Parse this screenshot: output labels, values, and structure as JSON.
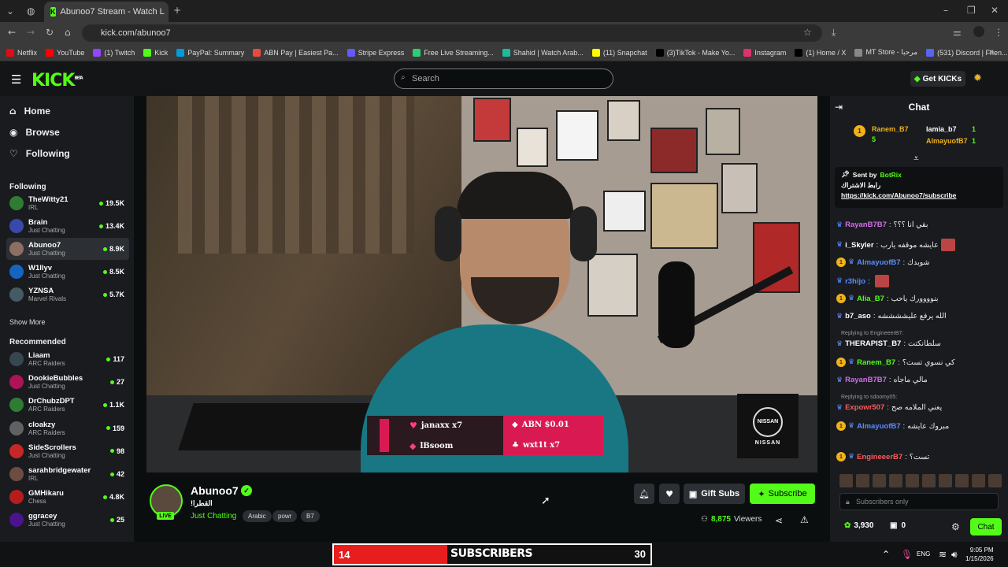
{
  "browser": {
    "tab_title": "Abunoo7 Stream - Watch L",
    "url": "kick.com/abunoo7",
    "bookmarks": [
      {
        "label": "Netflix",
        "color": "#e50914"
      },
      {
        "label": "YouTube",
        "color": "#ff0000"
      },
      {
        "label": "(1) Twitch",
        "color": "#9146ff"
      },
      {
        "label": "Kick",
        "color": "#53fc18"
      },
      {
        "label": "PayPal: Summary",
        "color": "#009cde"
      },
      {
        "label": "ABN Pay | Easiest Pa...",
        "color": "#e84b3c"
      },
      {
        "label": "Stripe Express",
        "color": "#635bff"
      },
      {
        "label": "Free Live Streaming...",
        "color": "#2ecc71"
      },
      {
        "label": "Shahid | Watch Arab...",
        "color": "#1abc9c"
      },
      {
        "label": "(11) Snapchat",
        "color": "#fffc00"
      },
      {
        "label": "(3)TikTok - Make Yo...",
        "color": "#000000"
      },
      {
        "label": "Instagram",
        "color": "#e1306c"
      },
      {
        "label": "(1) Home / X",
        "color": "#000000"
      },
      {
        "label": "MT Store - مرحبا",
        "color": "#888888"
      },
      {
        "label": "(531) Discord | Frien...",
        "color": "#5865f2"
      }
    ]
  },
  "header": {
    "logo": "KICK",
    "logo_sup": "BETA",
    "search_placeholder": "Search",
    "get_kicks": "Get KICKs"
  },
  "sidebar": {
    "nav": [
      {
        "label": "Home",
        "icon": "home-icon"
      },
      {
        "label": "Browse",
        "icon": "browse-icon"
      },
      {
        "label": "Following",
        "icon": "heart-icon"
      }
    ],
    "following_heading": "Following",
    "following": [
      {
        "name": "TheWitty21",
        "category": "IRL",
        "viewers": "19.5K",
        "color": "#2e7d32"
      },
      {
        "name": "Brain",
        "category": "Just Chatting",
        "viewers": "13.4K",
        "color": "#3949ab"
      },
      {
        "name": "Abunoo7",
        "category": "Just Chatting",
        "viewers": "8.9K",
        "color": "#8d6e63"
      },
      {
        "name": "W1llyv",
        "category": "Just Chatting",
        "viewers": "8.5K",
        "color": "#1565c0"
      },
      {
        "name": "YZNSA",
        "category": "Marvel Rivals",
        "viewers": "5.7K",
        "color": "#455a64"
      }
    ],
    "show_more": "Show More",
    "recommended_heading": "Recommended",
    "recommended": [
      {
        "name": "Liaam",
        "category": "ARC Raiders",
        "viewers": "117",
        "color": "#37474f"
      },
      {
        "name": "DookieBubbles",
        "category": "Just Chatting",
        "viewers": "27",
        "color": "#ad1457"
      },
      {
        "name": "DrChubzDPT",
        "category": "ARC Raiders",
        "viewers": "1.1K",
        "color": "#2e7d32"
      },
      {
        "name": "cloakzy",
        "category": "ARC Raiders",
        "viewers": "159",
        "color": "#616161"
      },
      {
        "name": "SideScrollers",
        "category": "Just Chatting",
        "viewers": "98",
        "color": "#c62828"
      },
      {
        "name": "sarahbridgewater",
        "category": "IRL",
        "viewers": "42",
        "color": "#6d4c41"
      },
      {
        "name": "GMHikaru",
        "category": "Chess",
        "viewers": "4.8K",
        "color": "#b71c1c"
      },
      {
        "name": "ggracey",
        "category": "Just Chatting",
        "viewers": "25",
        "color": "#4a148c"
      }
    ]
  },
  "video_overlay": {
    "alerts": [
      {
        "text": "janaxx x7"
      },
      {
        "text": "lBsoom"
      },
      {
        "text": "ABN $0.01"
      },
      {
        "text": "wxt1t x7"
      }
    ],
    "sponsor": "NISSAN"
  },
  "channel": {
    "name": "Abunoo7",
    "live": "LIVE",
    "title": "!القطرا",
    "category": "Just Chatting",
    "tags": [
      "Arabic",
      "powr",
      "B7"
    ],
    "gift_subs": "Gift Subs",
    "subscribe": "Subscribe",
    "viewers": "8,875",
    "viewers_label": "Viewers"
  },
  "chat": {
    "title": "Chat",
    "leaderboard": [
      {
        "rank": "1",
        "name": "Ranem_B7",
        "count": "5"
      },
      {
        "name": "lamia_b7",
        "count": "1"
      },
      {
        "name": "AlmayuofB7",
        "count": "1"
      }
    ],
    "pinned": {
      "sent_by": "Sent by",
      "bot": "BotRix",
      "line1": "رابط الاشتراك",
      "link": "https://kick.com/Abunoo7/subscribe"
    },
    "messages": [
      {
        "user": "RayanB7B7",
        "color": "#d36ee8",
        "text": "بقي انا ؟؟؟"
      },
      {
        "user": "i_Skyler",
        "color": "#ffffff",
        "text": "عايشه موقفه يارب"
      },
      {
        "user": "AlmayuofB7",
        "color": "#5b8cff",
        "text": "شوبدك"
      },
      {
        "user": "r3hijo",
        "color": "#5b8cff",
        "text": ""
      },
      {
        "user": "Alia_B7",
        "color": "#53fc18",
        "text": "بنوووورك ياحب"
      },
      {
        "user": "b7_aso",
        "color": "#ffffff",
        "text": "الله يرفع عليششششه"
      },
      {
        "user": "THERAPIST_B7",
        "color": "#ffffff",
        "text": "سلطانكتت"
      },
      {
        "user": "Ranem_B7",
        "color": "#53fc18",
        "text": "كي نسوي تست؟"
      },
      {
        "user": "RayanB7B7",
        "color": "#d36ee8",
        "text": "مالي ماجاه"
      },
      {
        "user": "Expowr507",
        "color": "#ff5a5a",
        "text": "يعني الملامه صح"
      },
      {
        "user": "AlmayuofB7",
        "color": "#5b8cff",
        "text": "مبروك عايشه"
      },
      {
        "user": "EngineeerB7",
        "color": "#ff5a5a",
        "text": "تست؟"
      }
    ],
    "replies": [
      "Replying to EngineeerB7:",
      "Replying to sdoomy05:"
    ],
    "input_placeholder": "Subscribers only",
    "kicks": "3,930",
    "gifts": "0",
    "send": "Chat"
  },
  "taskbar": {
    "sub_count": "14",
    "sub_label": "SUBSCRIBERS",
    "sub_goal": "30",
    "lang": "ENG",
    "time": "9:05 PM",
    "date": "1/15/2026"
  }
}
